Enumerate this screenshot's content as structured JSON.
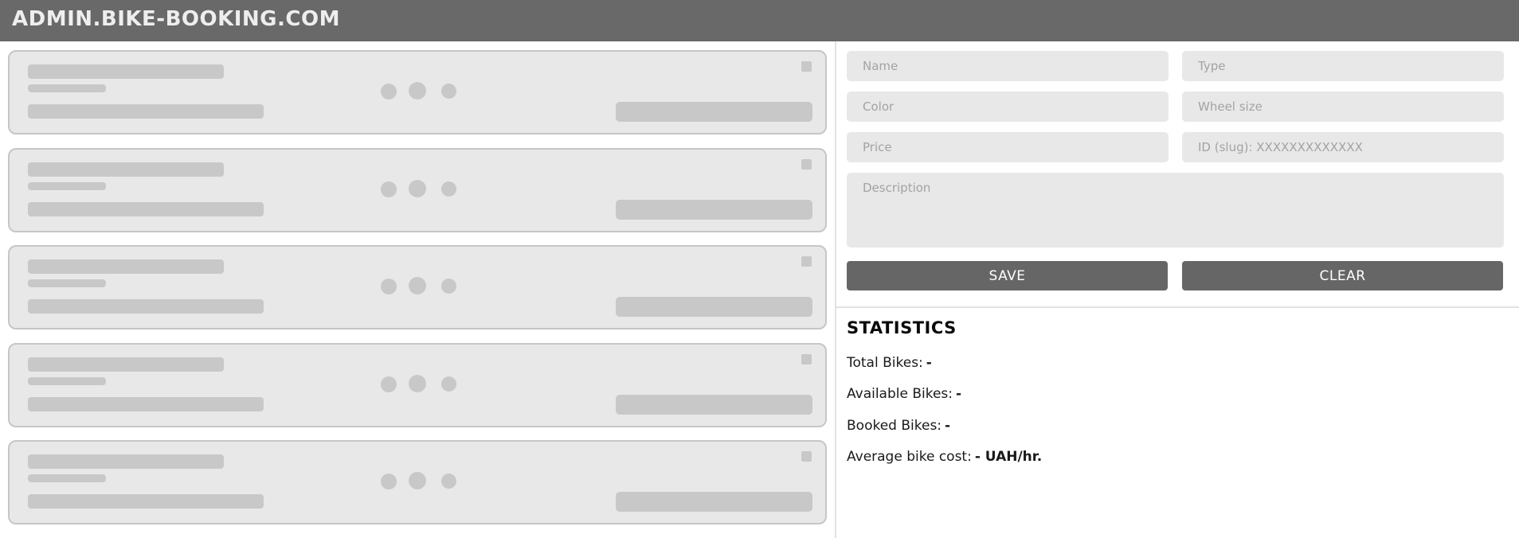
{
  "header": {
    "logo": "ADMIN.BIKE-BOOKING.COM"
  },
  "bike_list": {
    "loading_cards": 5
  },
  "form": {
    "name_placeholder": "Name",
    "type_placeholder": "Type",
    "color_placeholder": "Color",
    "wheel_size_placeholder": "Wheel size",
    "price_placeholder": "Price",
    "id_placeholder": "ID (slug): XXXXXXXXXXXXX",
    "description_placeholder": "Description",
    "save_label": "SAVE",
    "clear_label": "CLEAR"
  },
  "statistics": {
    "title": "STATISTICS",
    "total_label": "Total Bikes:",
    "total_value": "-",
    "available_label": "Available Bikes:",
    "available_value": "-",
    "booked_label": "Booked Bikes:",
    "booked_value": "-",
    "average_label": "Average bike cost:",
    "average_value": "- UAH/hr."
  },
  "colors": {
    "header_bg": "#696969",
    "card_bg": "#e8e8e8",
    "skeleton": "#c9c8c8",
    "button_bg": "#666666"
  }
}
